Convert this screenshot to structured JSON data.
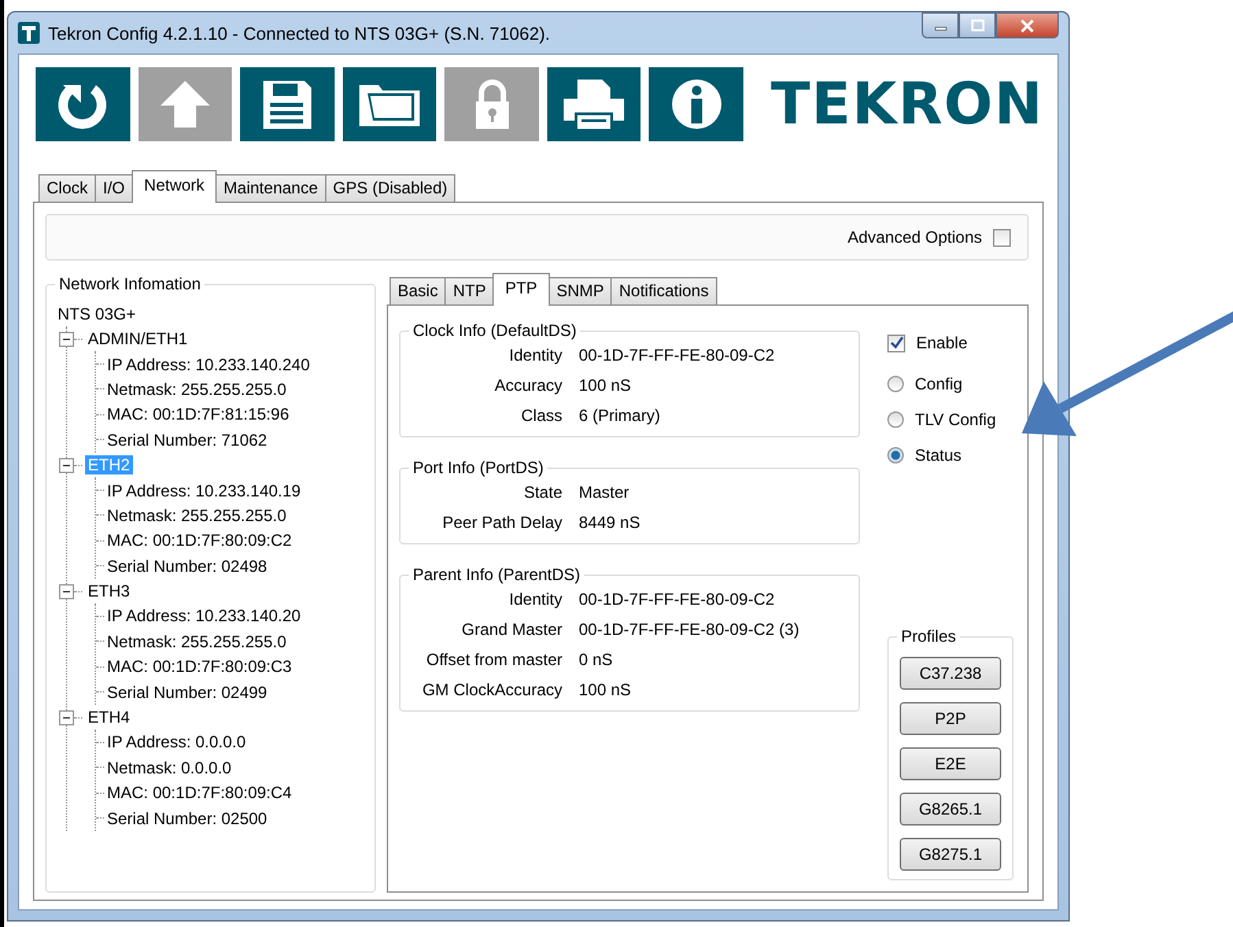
{
  "window": {
    "title": "Tekron Config 4.2.1.10 - Connected to NTS 03G+ (S.N. 71062)."
  },
  "toolbar": [
    {
      "disabled": false
    },
    {
      "disabled": true
    },
    {
      "disabled": false
    },
    {
      "disabled": false
    },
    {
      "disabled": true
    },
    {
      "disabled": false
    },
    {
      "disabled": false
    }
  ],
  "logo": "TEKRON",
  "main_tabs": [
    {
      "label": "Clock",
      "selected": false
    },
    {
      "label": "I/O",
      "selected": false
    },
    {
      "label": "Network",
      "selected": true
    },
    {
      "label": "Maintenance",
      "selected": false
    },
    {
      "label": "GPS (Disabled)",
      "selected": false
    }
  ],
  "advanced_options": {
    "label": "Advanced Options",
    "checked": false
  },
  "network_info": {
    "title": "Network Infomation",
    "root": "NTS 03G+",
    "interfaces": [
      {
        "label": "ADMIN/ETH1",
        "expanded": true,
        "selected": false,
        "children": [
          "IP Address: 10.233.140.240",
          "Netmask: 255.255.255.0",
          "MAC: 00:1D:7F:81:15:96",
          "Serial Number: 71062"
        ]
      },
      {
        "label": "ETH2",
        "expanded": true,
        "selected": true,
        "children": [
          "IP Address: 10.233.140.19",
          "Netmask: 255.255.255.0",
          "MAC: 00:1D:7F:80:09:C2",
          "Serial Number: 02498"
        ]
      },
      {
        "label": "ETH3",
        "expanded": true,
        "selected": false,
        "children": [
          "IP Address: 10.233.140.20",
          "Netmask: 255.255.255.0",
          "MAC: 00:1D:7F:80:09:C3",
          "Serial Number: 02499"
        ]
      },
      {
        "label": "ETH4",
        "expanded": true,
        "selected": false,
        "children": [
          "IP Address: 0.0.0.0",
          "Netmask: 0.0.0.0",
          "MAC: 00:1D:7F:80:09:C4",
          "Serial Number: 02500"
        ]
      }
    ]
  },
  "sub_tabs": [
    {
      "label": "Basic",
      "selected": false
    },
    {
      "label": "NTP",
      "selected": false
    },
    {
      "label": "PTP",
      "selected": true
    },
    {
      "label": "SNMP",
      "selected": false
    },
    {
      "label": "Notifications",
      "selected": false
    }
  ],
  "groups": [
    {
      "title": "Clock Info (DefaultDS)",
      "rows": [
        {
          "label": "Identity",
          "value": "00-1D-7F-FF-FE-80-09-C2"
        },
        {
          "label": "Accuracy",
          "value": "100 nS"
        },
        {
          "label": "Class",
          "value": "6 (Primary)"
        }
      ]
    },
    {
      "title": "Port Info (PortDS)",
      "rows": [
        {
          "label": "State",
          "value": "Master"
        },
        {
          "label": "Peer Path Delay",
          "value": "8449 nS"
        }
      ]
    },
    {
      "title": "Parent Info (ParentDS)",
      "rows": [
        {
          "label": "Identity",
          "value": "00-1D-7F-FF-FE-80-09-C2"
        },
        {
          "label": "Grand Master",
          "value": "00-1D-7F-FF-FE-80-09-C2 (3)"
        },
        {
          "label": "Offset from master",
          "value": "0 nS"
        },
        {
          "label": "GM ClockAccuracy",
          "value": "100 nS"
        }
      ]
    }
  ],
  "enable": {
    "label": "Enable",
    "checked": true
  },
  "modes": [
    {
      "label": "Config",
      "selected": false
    },
    {
      "label": "TLV Config",
      "selected": false
    },
    {
      "label": "Status",
      "selected": true
    }
  ],
  "profiles": {
    "title": "Profiles",
    "buttons": [
      "C37.238",
      "P2P",
      "E2E",
      "G8265.1",
      "G8275.1"
    ]
  }
}
